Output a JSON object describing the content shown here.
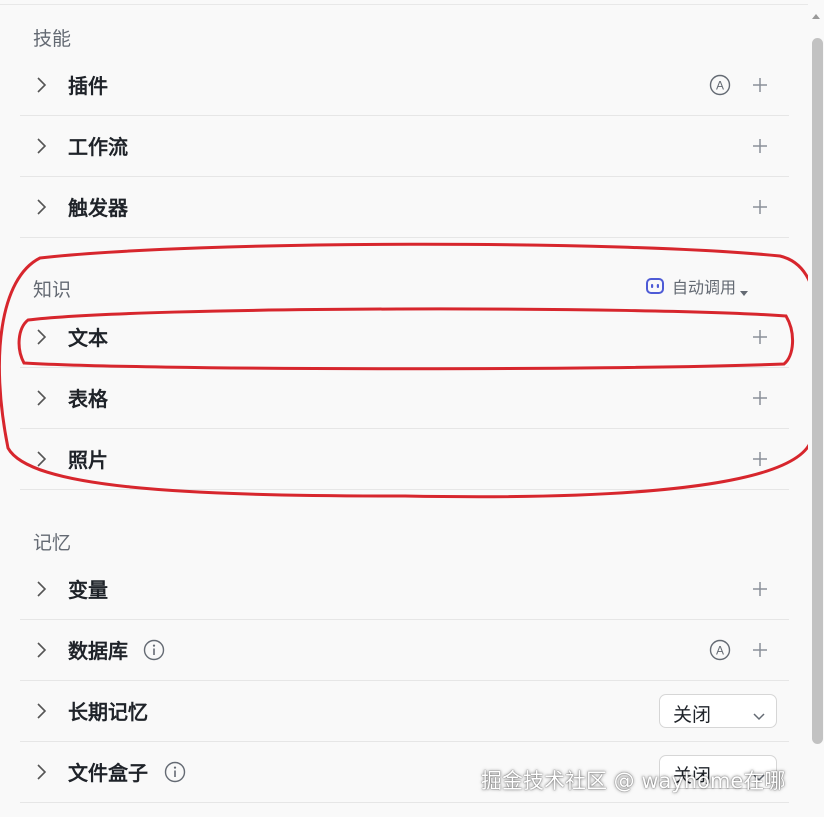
{
  "sections": {
    "skills": {
      "title": "技能",
      "items": [
        {
          "label": "插件",
          "has_auto_badge": true,
          "auto_badge": "A"
        },
        {
          "label": "工作流"
        },
        {
          "label": "触发器"
        }
      ]
    },
    "knowledge": {
      "title": "知识",
      "auto_call_label": "自动调用",
      "items": [
        {
          "label": "文本"
        },
        {
          "label": "表格"
        },
        {
          "label": "照片"
        }
      ]
    },
    "memory": {
      "title": "记忆",
      "items": [
        {
          "label": "变量"
        },
        {
          "label": "数据库",
          "has_info": true,
          "has_auto_badge": true,
          "auto_badge": "A"
        },
        {
          "label": "长期记忆",
          "select_value": "关闭"
        },
        {
          "label": "文件盒子",
          "has_info": true,
          "select_value": "关闭"
        }
      ]
    }
  },
  "watermark": "掘金技术社区 @ wayhome在哪",
  "colors": {
    "highlight": "#d7262d",
    "accent_robot": "#4e5bd6",
    "text_primary": "#1f2329",
    "text_secondary": "#646a73"
  },
  "icons": [
    "chevron-right-icon",
    "plus-icon",
    "auto-badge-icon",
    "info-icon",
    "robot-icon",
    "caret-down-icon"
  ]
}
